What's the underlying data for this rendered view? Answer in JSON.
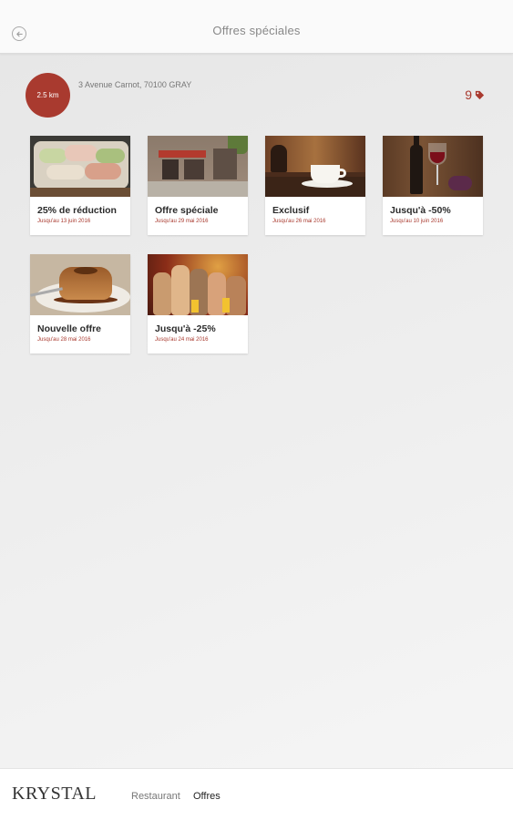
{
  "header": {
    "title": "Offres spéciales",
    "back_icon": "back-arrow-icon"
  },
  "location": {
    "distance": "2.5 km",
    "address": "3 Avenue Carnot, 70100 GRAY",
    "offer_count": "9",
    "offer_icon": "tag-icon"
  },
  "offers": [
    {
      "title": "25% de réduction",
      "date": "Jusqu'au 13 juin 2016"
    },
    {
      "title": "Offre spéciale",
      "date": "Jusqu'au 29 mai 2016"
    },
    {
      "title": "Exclusif",
      "date": "Jusqu'au 26 mai 2016"
    },
    {
      "title": "Jusqu'à -50%",
      "date": "Jusqu'au 10 juin 2016"
    },
    {
      "title": "Nouvelle offre",
      "date": "Jusqu'au 28 mai 2016"
    },
    {
      "title": "Jusqu'à -25%",
      "date": "Jusqu'au 24 mai 2016"
    }
  ],
  "footer": {
    "brand": "KRYSTAL",
    "nav_restaurant": "Restaurant",
    "nav_offres": "Offres"
  },
  "colors": {
    "accent": "#a93a2f",
    "background": "#ececec",
    "header_bg": "#fafafa"
  }
}
